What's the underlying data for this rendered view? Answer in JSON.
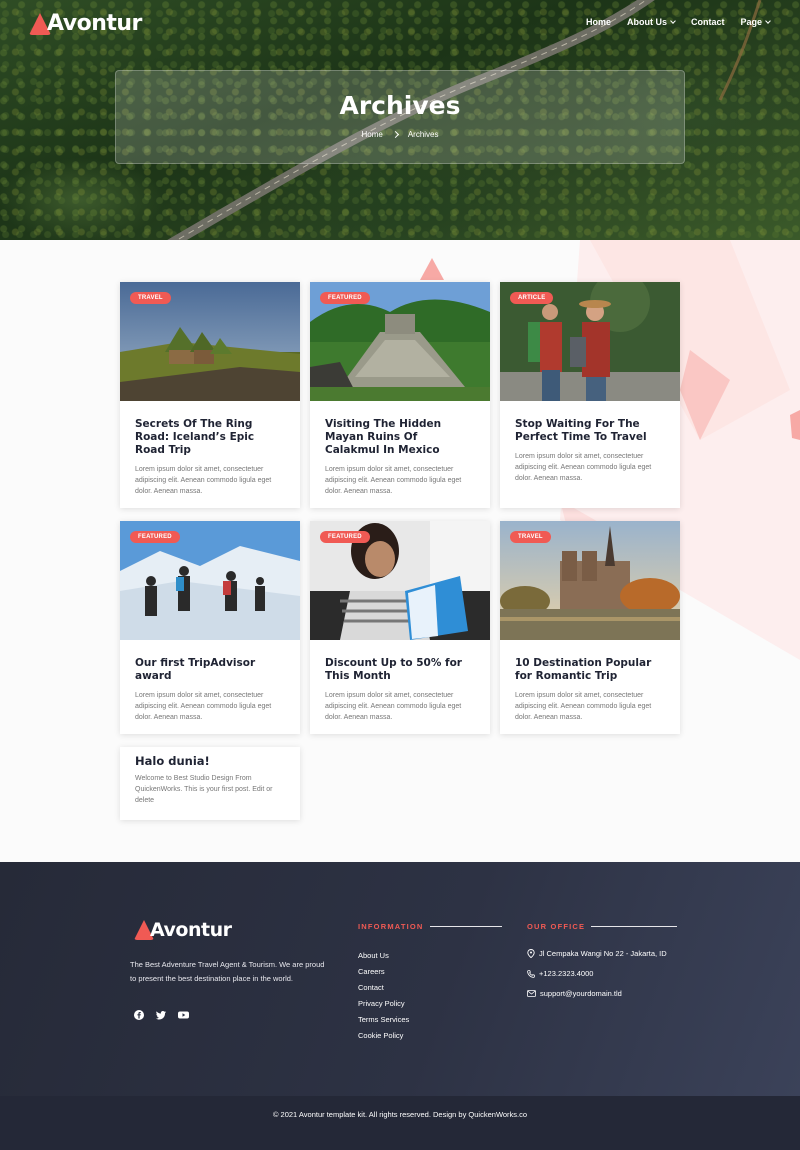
{
  "brand": {
    "name": "Avontur",
    "accent": "#f05a54"
  },
  "nav": {
    "items": [
      {
        "label": "Home"
      },
      {
        "label": "About Us"
      },
      {
        "label": "Contact"
      },
      {
        "label": "Page"
      }
    ]
  },
  "hero": {
    "title": "Archives",
    "breadcrumb": [
      "Home",
      "Archives"
    ]
  },
  "posts": [
    {
      "badge": "TRAVEL",
      "title": "Secrets Of The Ring Road: Iceland’s Epic Road Trip",
      "excerpt": "Lorem ipsum dolor sit amet, consectetuer adipiscing elit. Aenean commodo ligula eget dolor. Aenean massa."
    },
    {
      "badge": "FEATURED",
      "title": "Visiting The Hidden Mayan Ruins Of Calakmul In Mexico",
      "excerpt": "Lorem ipsum dolor sit amet, consectetuer adipiscing elit. Aenean commodo ligula eget dolor. Aenean massa."
    },
    {
      "badge": "ARTICLE",
      "title": "Stop Waiting For The Perfect Time To Travel",
      "excerpt": "Lorem ipsum dolor sit amet, consectetuer adipiscing elit. Aenean commodo ligula eget dolor. Aenean massa."
    },
    {
      "badge": "FEATURED",
      "title": "Our first TripAdvisor award",
      "excerpt": "Lorem ipsum dolor sit amet, consectetuer adipiscing elit. Aenean commodo ligula eget dolor. Aenean massa."
    },
    {
      "badge": "FEATURED",
      "title": "Discount Up to 50% for This Month",
      "excerpt": "Lorem ipsum dolor sit amet, consectetuer adipiscing elit. Aenean commodo ligula eget dolor. Aenean massa."
    },
    {
      "badge": "TRAVEL",
      "title": "10 Destination Popular for Romantic Trip",
      "excerpt": "Lorem ipsum dolor sit amet, consectetuer adipiscing elit. Aenean commodo ligula eget dolor. Aenean massa."
    },
    {
      "title": "Halo dunia!",
      "excerpt": "Welcome to Best Studio Design From QuickenWorks. This is your first post. Edit or delete"
    }
  ],
  "footer": {
    "about": "The Best Adventure Travel Agent & Tourism. We are proud to present the best destination place in the world.",
    "social_icons": [
      "facebook-icon",
      "twitter-icon",
      "youtube-icon"
    ],
    "info_title": "INFORMATION",
    "info_links": [
      "About Us",
      "Careers",
      "Contact",
      "Privacy Policy",
      "Terms Services",
      "Cookie Policy"
    ],
    "office_title": "OUR OFFICE",
    "office": {
      "address": "Jl Cempaka Wangi No 22 - Jakarta, ID",
      "phone": "+123.2323.4000",
      "email": "support@yourdomain.tld"
    },
    "copyright": "© 2021 Avontur template kit. All rights reserved. Design by QuickenWorks.co"
  }
}
